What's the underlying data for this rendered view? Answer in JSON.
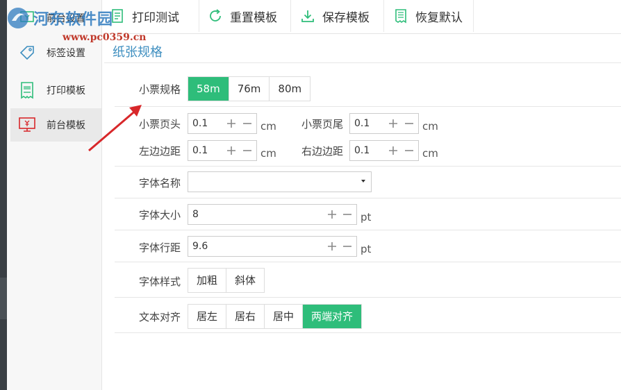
{
  "sidebar": {
    "items": [
      {
        "label": "前台设置"
      },
      {
        "label": "标签设置"
      },
      {
        "label": "打印模板"
      },
      {
        "label": "前台模板"
      }
    ]
  },
  "toolbar": {
    "buttons": [
      {
        "label": "打印测试",
        "icon": "printer-doc-icon"
      },
      {
        "label": "重置模板",
        "icon": "refresh-icon"
      },
      {
        "label": "保存模板",
        "icon": "download-icon"
      },
      {
        "label": "恢复默认",
        "icon": "receipt-icon"
      }
    ]
  },
  "watermark": {
    "text": "河东软件园",
    "url": "www.pc0359.cn"
  },
  "section": {
    "title": "纸张规格"
  },
  "form": {
    "receipt_size": {
      "label": "小票规格",
      "options": [
        "58m",
        "76m",
        "80m"
      ],
      "selected": "58m"
    },
    "header": {
      "label": "小票页头",
      "value": "0.1",
      "unit": "cm"
    },
    "footer": {
      "label": "小票页尾",
      "value": "0.1",
      "unit": "cm"
    },
    "left_margin": {
      "label": "左边边距",
      "value": "0.1",
      "unit": "cm"
    },
    "right_margin": {
      "label": "右边边距",
      "value": "0.1",
      "unit": "cm"
    },
    "font_name": {
      "label": "字体名称",
      "value": ""
    },
    "font_size": {
      "label": "字体大小",
      "value": "8",
      "unit": "pt"
    },
    "line_spacing": {
      "label": "字体行距",
      "value": "9.6",
      "unit": "pt"
    },
    "font_style": {
      "label": "字体样式",
      "options": [
        "加粗",
        "斜体"
      ]
    },
    "text_align": {
      "label": "文本对齐",
      "options": [
        "居左",
        "居右",
        "居中",
        "两端对齐"
      ],
      "selected": "两端对齐"
    }
  },
  "colors": {
    "accent": "#2ebd7a",
    "title": "#3f8fc0",
    "arrow": "#d8272a"
  }
}
